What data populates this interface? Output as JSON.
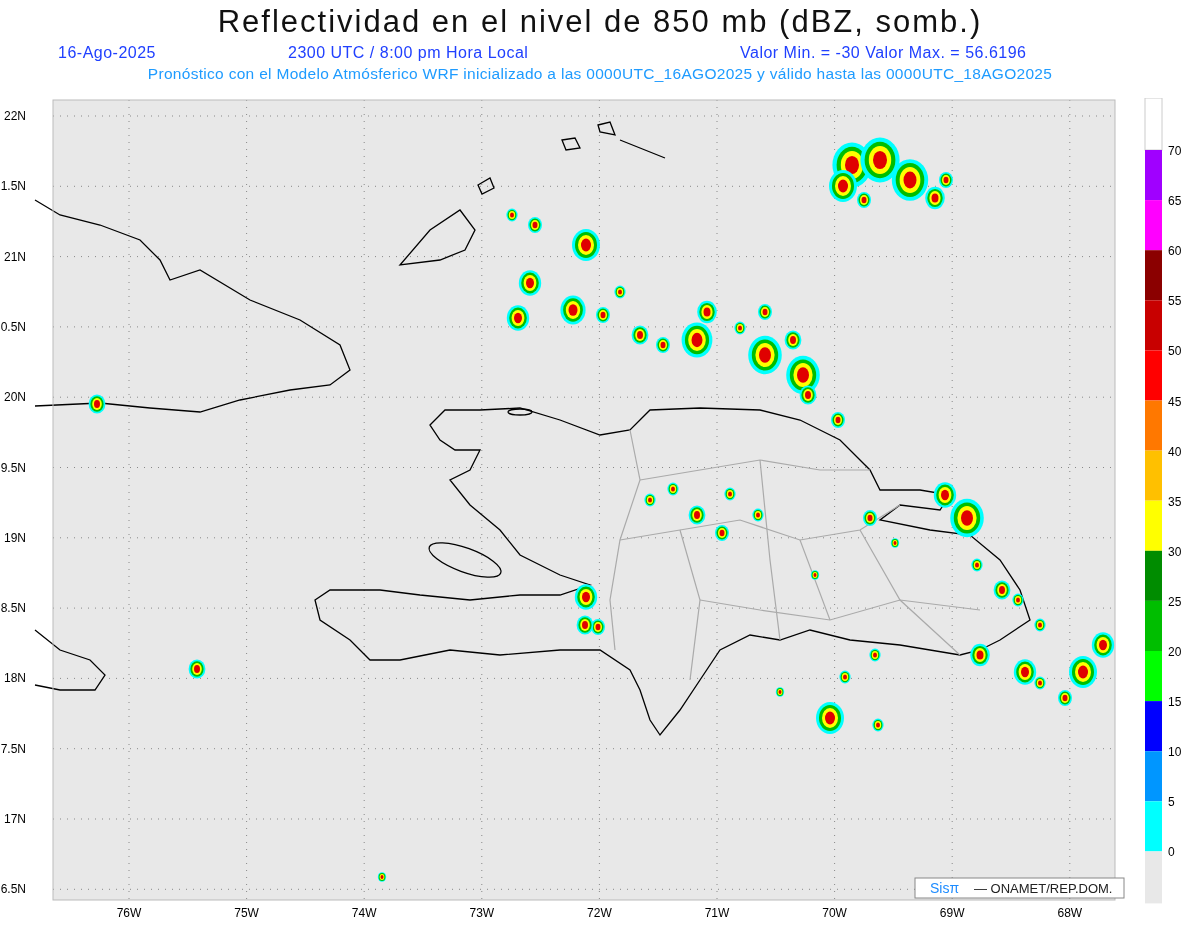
{
  "title": "Reflectividad en el nivel de 850 mb (dBZ, somb.)",
  "subtitle": {
    "date": "16-Ago-2025",
    "time": "2300 UTC / 8:00 pm Hora Local",
    "range": "Valor Min. = -30  Valor Max. = 56.6196"
  },
  "description": "Pronóstico con el Modelo Atmósferico WRF inicializado a las 0000UTC_16AGO2025 y válido hasta las  0000UTC_18AGO2025",
  "map": {
    "lat_labels": [
      "22N",
      "1.5N",
      "21N",
      "0.5N",
      "20N",
      "9.5N",
      "19N",
      "8.5N",
      "18N",
      "7.5N",
      "17N",
      "6.5N"
    ],
    "lon_labels": [
      "76W",
      "75W",
      "74W",
      "73W",
      "72W",
      "71W",
      "70W",
      "69W",
      "68W"
    ],
    "credit": {
      "brand": "Sisπ",
      "text": "— ONAMET/REP.DOM."
    }
  },
  "legend": [
    {
      "label": "70",
      "color": "#a000ff"
    },
    {
      "label": "65",
      "color": "#ff00ff"
    },
    {
      "label": "60",
      "color": "#8b0000"
    },
    {
      "label": "55",
      "color": "#c80000"
    },
    {
      "label": "50",
      "color": "#ff0000"
    },
    {
      "label": "45",
      "color": "#ff7800"
    },
    {
      "label": "40",
      "color": "#ffc000"
    },
    {
      "label": "35",
      "color": "#ffff00"
    },
    {
      "label": "30",
      "color": "#008c00"
    },
    {
      "label": "25",
      "color": "#00be00"
    },
    {
      "label": "20",
      "color": "#00ff00"
    },
    {
      "label": "15",
      "color": "#0000ff"
    },
    {
      "label": "10",
      "color": "#0096ff"
    },
    {
      "label": "5",
      "color": "#00ffff"
    },
    {
      "label": "0",
      "color": "#e8e8e8"
    }
  ]
}
